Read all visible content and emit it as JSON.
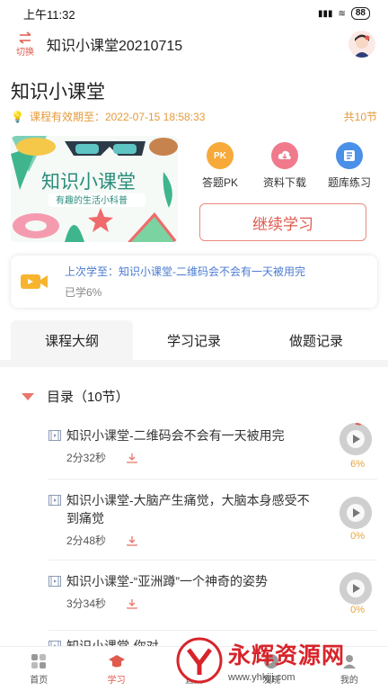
{
  "status_bar": {
    "time": "上午11:32",
    "battery": "88"
  },
  "header": {
    "switch_label": "切换",
    "title": "知识小课堂20210715"
  },
  "course": {
    "title": "知识小课堂",
    "validity": "课程有效期至：2022-07-15 18:58:33",
    "lesson_count": "共10节",
    "cover_title": "知识小课堂",
    "cover_subtitle": "有趣的生活小科普"
  },
  "actions": [
    {
      "label": "答题PK",
      "badge": "PK",
      "color": "#f7a93a"
    },
    {
      "label": "资料下载",
      "color": "#f07a8c"
    },
    {
      "label": "题库练习",
      "color": "#4a8fe8"
    }
  ],
  "continue_label": "继续学习",
  "last_study": {
    "line1": "上次学至：知识小课堂-二维码会不会有一天被用完",
    "line2": "已学6%"
  },
  "tabs": [
    "课程大纲",
    "学习记录",
    "做题记录"
  ],
  "outline": {
    "header": "目录（10节）",
    "lessons": [
      {
        "name": "知识小课堂-二维码会不会有一天被用完",
        "duration": "2分32秒",
        "progress": "6%"
      },
      {
        "name": "知识小课堂-大脑产生痛觉，大脑本身感受不到痛觉",
        "duration": "2分48秒",
        "progress": "0%"
      },
      {
        "name": "知识小课堂-“亚洲蹲”一个神奇的姿势",
        "duration": "3分34秒",
        "progress": "0%"
      },
      {
        "name": "知识小课堂-你对...",
        "duration": "",
        "progress": ""
      }
    ]
  },
  "bottom_nav": [
    "首页",
    "学习",
    "直播",
    "发现",
    "我的"
  ],
  "watermark": {
    "text": "永辉资源网",
    "url": "www.yhkjjj.com"
  }
}
